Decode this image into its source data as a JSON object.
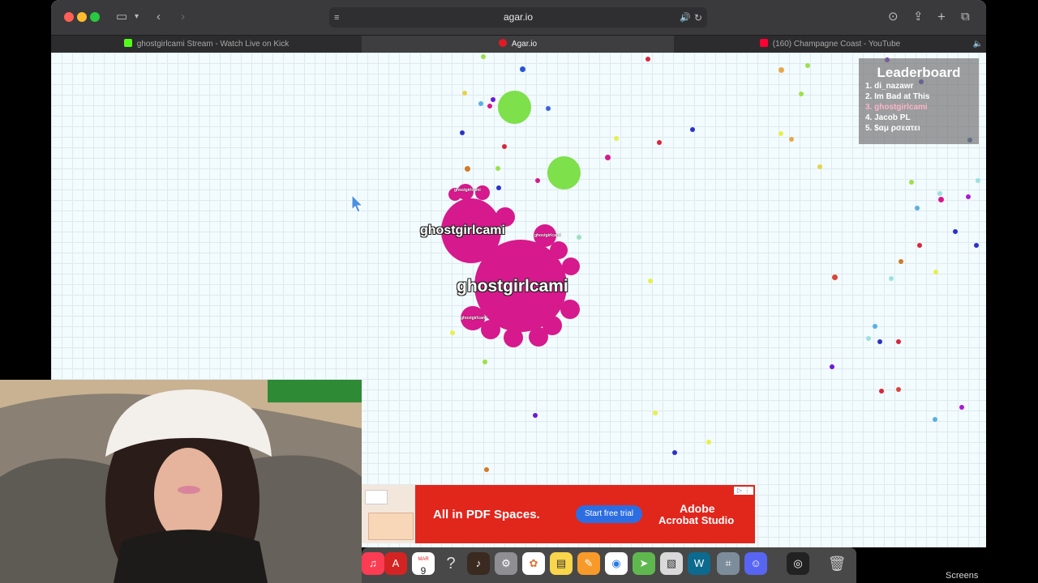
{
  "browser": {
    "address": "agar.io",
    "tabs": [
      {
        "label": "ghostgirlcami Stream - Watch Live on Kick",
        "icon": "kick-icon",
        "active": false
      },
      {
        "label": "Agar.io",
        "icon": "agario-icon",
        "active": true
      },
      {
        "label": "(160) Champagne Coast - YouTube",
        "icon": "youtube-icon",
        "active": false
      }
    ]
  },
  "game": {
    "player_name": "ghostgirlcami",
    "leaderboard": {
      "title": "Leaderboard",
      "entries": [
        "1. di_nazawr",
        "2. Im Bad at This",
        "3. ghostgirlcami",
        "4. Jacob PL",
        "5. $αμ ρσεατει"
      ],
      "highlight_index": 2
    },
    "colors": {
      "player": "#d6198c",
      "virus": "#7ee04a",
      "grid": "#dfeaee",
      "background": "#f2fbfd"
    }
  },
  "ad": {
    "headline": "All in PDF Spaces.",
    "cta": "Start free trial",
    "brand_line1": "Adobe",
    "brand_line2": "Acrobat Studio"
  },
  "dock": {
    "apps": [
      "music-icon",
      "acrobat-icon",
      "calendar-icon",
      "help-icon",
      "garageband-icon",
      "settings-icon",
      "photos-icon",
      "notes-icon",
      "pages-icon",
      "chrome-icon",
      "maps-icon",
      "preview-icon",
      "webex-icon",
      "screenshot-icon",
      "discord-icon",
      "obs-icon",
      "trash-icon"
    ],
    "calendar_month": "MAR",
    "calendar_day": "9"
  },
  "desktop_label": "Screens"
}
